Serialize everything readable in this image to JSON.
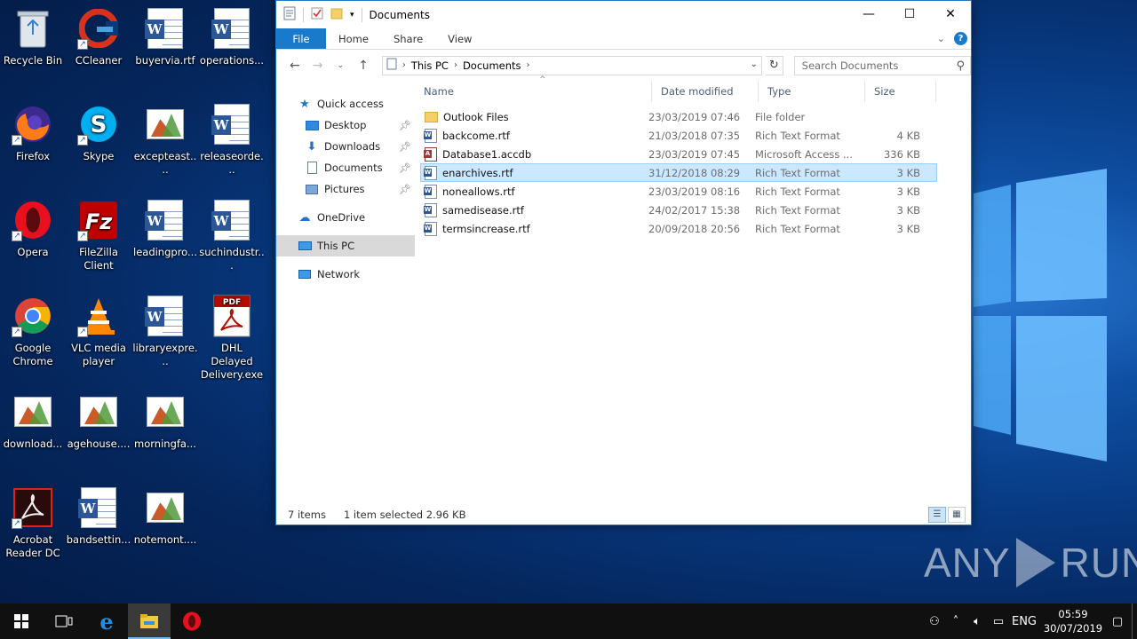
{
  "desktop": {
    "icons": [
      {
        "label": "Recycle Bin",
        "icon": "recycle-bin-icon"
      },
      {
        "label": "CCleaner",
        "icon": "ccleaner-icon"
      },
      {
        "label": "buyervia.rtf",
        "icon": "word-document-icon"
      },
      {
        "label": "operations...",
        "icon": "word-document-icon"
      },
      {
        "label": "Firefox",
        "icon": "firefox-icon"
      },
      {
        "label": "Skype",
        "icon": "skype-icon"
      },
      {
        "label": "excepteast....",
        "icon": "image-file-icon"
      },
      {
        "label": "releaseorde...",
        "icon": "word-document-icon"
      },
      {
        "label": "Opera",
        "icon": "opera-icon"
      },
      {
        "label": "FileZilla Client",
        "icon": "filezilla-icon"
      },
      {
        "label": "leadingpro...",
        "icon": "word-document-icon"
      },
      {
        "label": "suchindustr...",
        "icon": "word-document-icon"
      },
      {
        "label": "Google Chrome",
        "icon": "chrome-icon"
      },
      {
        "label": "VLC media player",
        "icon": "vlc-icon"
      },
      {
        "label": "libraryexpre...",
        "icon": "word-document-icon"
      },
      {
        "label": "DHL Delayed Delivery.exe",
        "icon": "pdf-icon"
      },
      {
        "label": "download...",
        "icon": "image-file-icon"
      },
      {
        "label": "agehouse....",
        "icon": "image-file-icon"
      },
      {
        "label": "morningfa...",
        "icon": "image-file-icon"
      },
      {
        "label": "Acrobat Reader DC",
        "icon": "acrobat-icon"
      },
      {
        "label": "bandsettin...",
        "icon": "word-document-icon"
      },
      {
        "label": "notemont....",
        "icon": "image-file-icon"
      }
    ]
  },
  "window": {
    "title": "Documents",
    "tabs": [
      "File",
      "Home",
      "Share",
      "View"
    ],
    "address": {
      "parts": [
        "This PC",
        "Documents"
      ]
    },
    "search_placeholder": "Search Documents",
    "nav": {
      "quick_access": "Quick access",
      "items": [
        "Desktop",
        "Downloads",
        "Documents",
        "Pictures"
      ],
      "onedrive": "OneDrive",
      "this_pc": "This PC",
      "network": "Network"
    },
    "columns": {
      "name": "Name",
      "date": "Date modified",
      "type": "Type",
      "size": "Size"
    },
    "files": [
      {
        "name": "Outlook Files",
        "date": "23/03/2019 07:46",
        "type": "File folder",
        "size": "",
        "kind": "folder"
      },
      {
        "name": "backcome.rtf",
        "date": "21/03/2018 07:35",
        "type": "Rich Text Format",
        "size": "4 KB",
        "kind": "rtf"
      },
      {
        "name": "Database1.accdb",
        "date": "23/03/2019 07:45",
        "type": "Microsoft Access ...",
        "size": "336 KB",
        "kind": "accdb"
      },
      {
        "name": "enarchives.rtf",
        "date": "31/12/2018 08:29",
        "type": "Rich Text Format",
        "size": "3 KB",
        "kind": "rtf",
        "selected": true
      },
      {
        "name": "noneallows.rtf",
        "date": "23/03/2019 08:16",
        "type": "Rich Text Format",
        "size": "3 KB",
        "kind": "rtf"
      },
      {
        "name": "samedisease.rtf",
        "date": "24/02/2017 15:38",
        "type": "Rich Text Format",
        "size": "3 KB",
        "kind": "rtf"
      },
      {
        "name": "termsincrease.rtf",
        "date": "20/09/2018 20:56",
        "type": "Rich Text Format",
        "size": "3 KB",
        "kind": "rtf"
      }
    ],
    "status": {
      "count": "7 items",
      "selected": "1 item selected  2.96 KB"
    }
  },
  "taskbar": {
    "language": "ENG",
    "time": "05:59",
    "date": "30/07/2019"
  },
  "watermark": {
    "left": "ANY",
    "right": "RUN"
  },
  "colors": {
    "accent": "#1979ca",
    "selection": "#cce8ff",
    "taskbar": "#101010"
  }
}
